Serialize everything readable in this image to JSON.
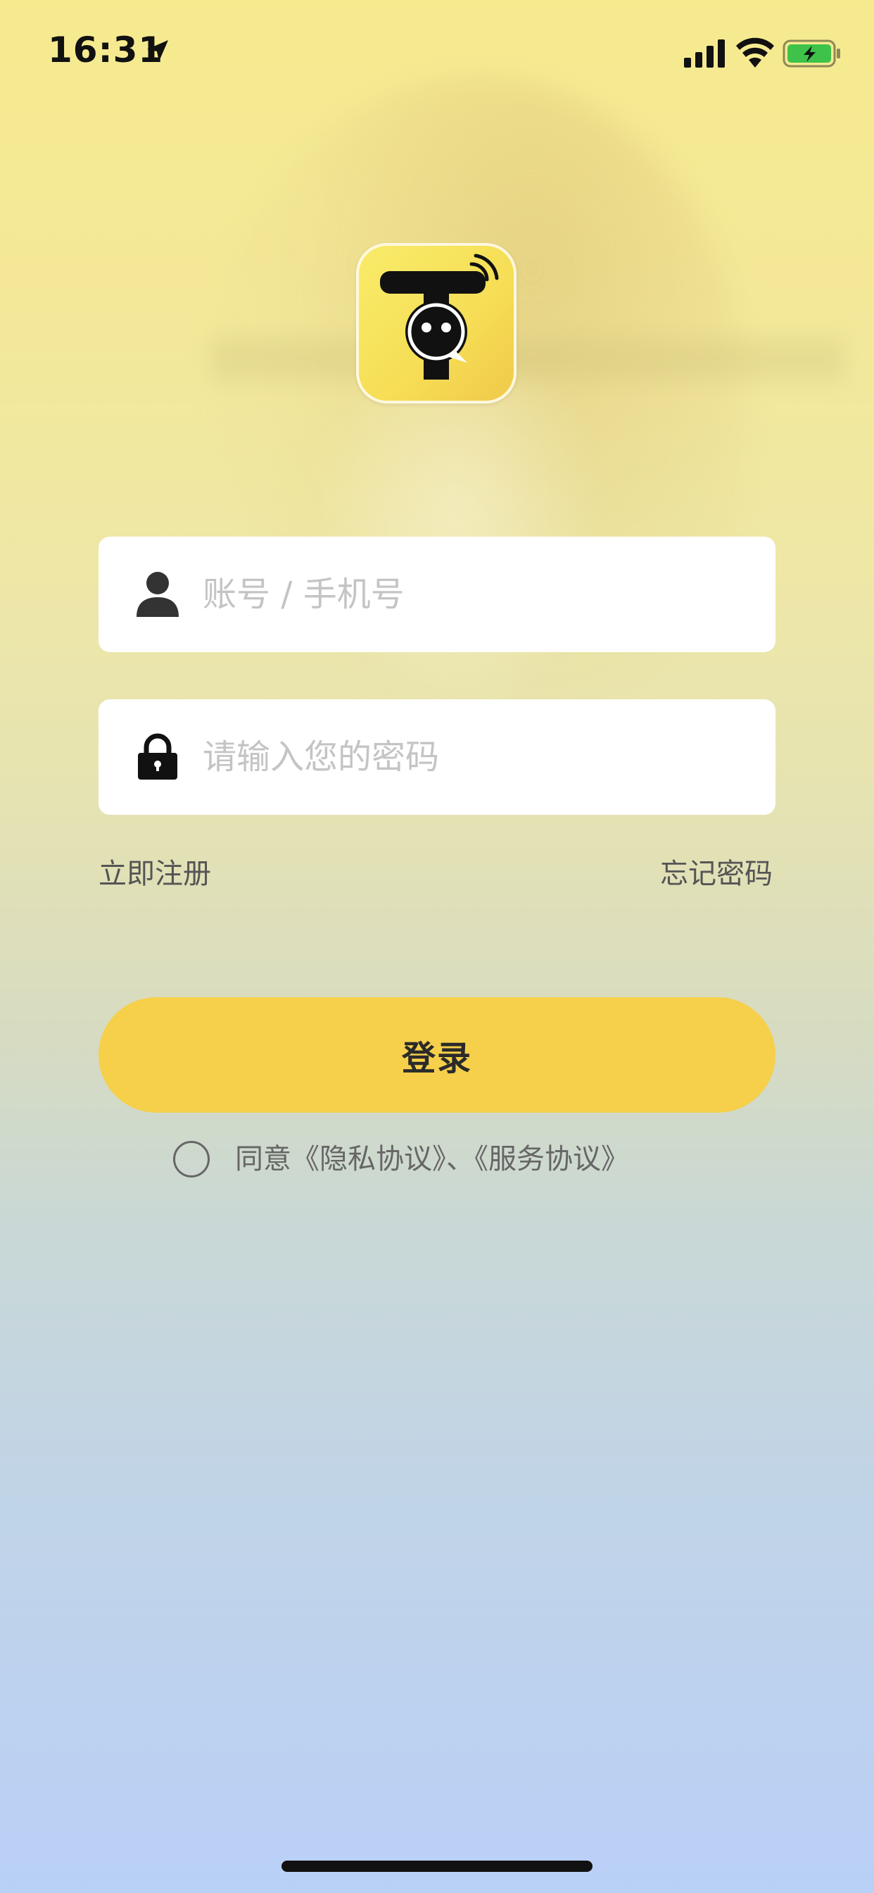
{
  "status_bar": {
    "time": "16:31",
    "icons": [
      "location-arrow-icon",
      "signal-icon",
      "wifi-icon",
      "battery-charging-icon"
    ]
  },
  "logo": {
    "name": "app-logo",
    "colors": {
      "background": "#f6dd55",
      "glyph": "#111111"
    }
  },
  "login_form": {
    "account": {
      "icon": "user-icon",
      "value": "",
      "placeholder": "账号 / 手机号"
    },
    "password": {
      "icon": "lock-icon",
      "value": "",
      "placeholder": "请输入您的密码"
    },
    "register_link": "立即注册",
    "forgot_link": "忘记密码",
    "login_button": "登录"
  },
  "agreement": {
    "checked": false,
    "text": "同意《隐私协议》、《服务协议》"
  },
  "colors": {
    "accent": "#f6cf4b",
    "background_top": "#f6ea8f",
    "background_bottom": "#b9d0f7"
  }
}
